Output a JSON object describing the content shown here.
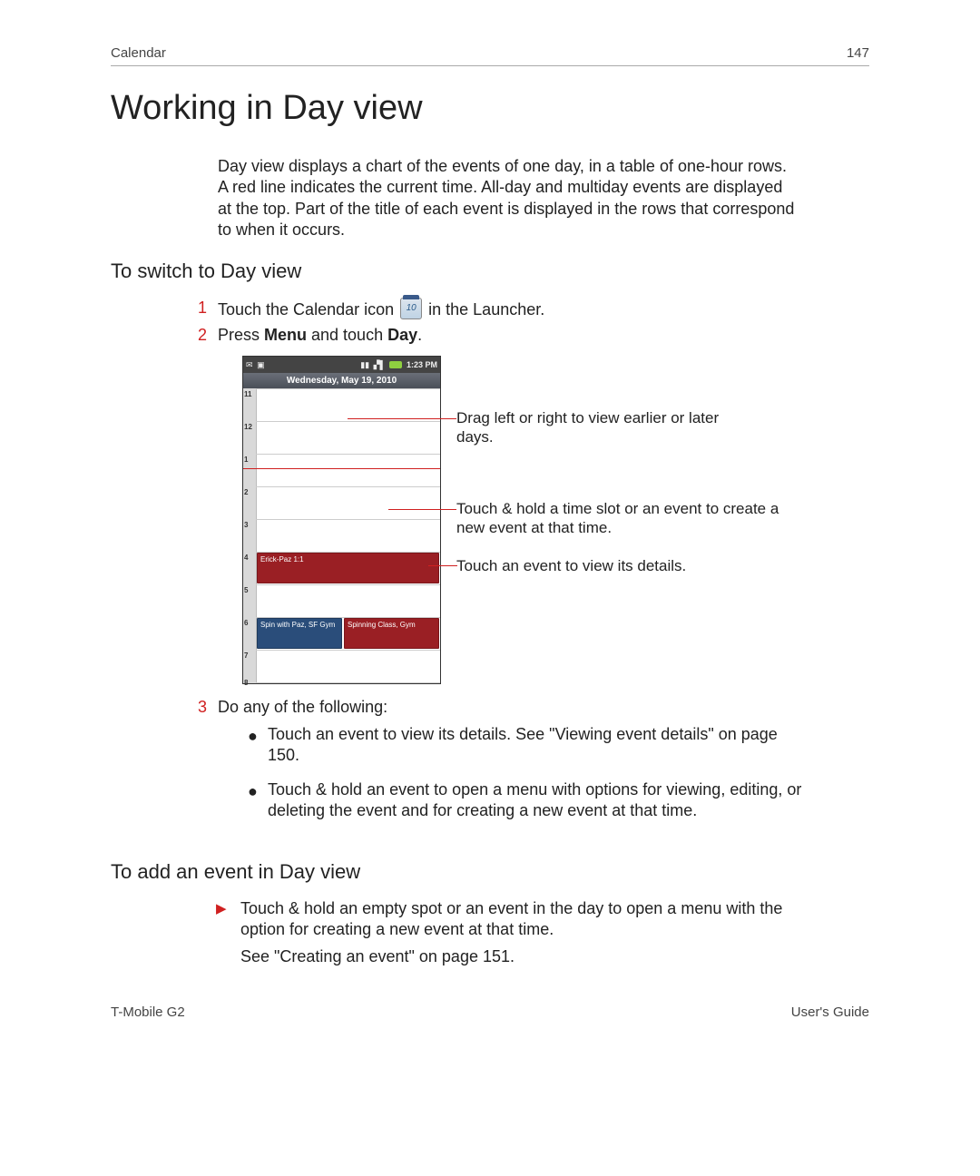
{
  "header": {
    "section": "Calendar",
    "page_num": "147"
  },
  "title": "Working in Day view",
  "intro": "Day view displays a chart of the events of one day, in a table of one-hour rows. A red line indicates the current time. All-day and multiday events are displayed at the top. Part of the title of each event is displayed in the rows that correspond to when it occurs.",
  "sub1": "To switch to Day view",
  "steps": {
    "s1_pre": "Touch the Calendar icon ",
    "s1_post": " in the Launcher.",
    "s2_pre": "Press ",
    "s2_menu": "Menu",
    "s2_mid": " and touch ",
    "s2_day": "Day",
    "s2_post": ".",
    "s3": "Do any of the following:"
  },
  "bullets": [
    "Touch an event to view its details. See \"Viewing event details\" on page 150.",
    "Touch & hold an event to open a menu with options for viewing, editing, or deleting the event and for creating a new event at that time."
  ],
  "sub2": "To add an event in Day view",
  "tri_step": "Touch & hold an empty spot or an event in the day to open a menu with the option for creating a new event at that time.",
  "tri_step2": "See \"Creating an event\" on page 151.",
  "footer": {
    "left": "T-Mobile G2",
    "right": "User's Guide"
  },
  "figure": {
    "status_time": "1:23 PM",
    "date": "Wednesday, May 19, 2010",
    "hours": [
      "11",
      "12",
      "1",
      "2",
      "3",
      "4",
      "5",
      "6",
      "7",
      "8"
    ],
    "events": {
      "erick": "Erick-Paz 1:1",
      "spin": "Spin with Paz, SF Gym",
      "spinning": "Spinning Class, Gym"
    }
  },
  "callouts": {
    "c1": "Drag left or right to view earlier or later days.",
    "c2": "Touch & hold a time slot or an event to create a new event at that time.",
    "c3": "Touch an event to view its details."
  }
}
